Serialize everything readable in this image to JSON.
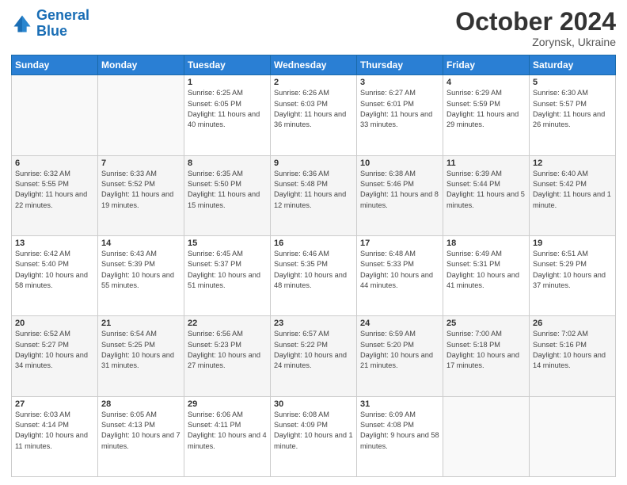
{
  "header": {
    "logo_line1": "General",
    "logo_line2": "Blue",
    "month_title": "October 2024",
    "location": "Zorynsk, Ukraine"
  },
  "weekdays": [
    "Sunday",
    "Monday",
    "Tuesday",
    "Wednesday",
    "Thursday",
    "Friday",
    "Saturday"
  ],
  "weeks": [
    [
      {
        "day": "",
        "sunrise": "",
        "sunset": "",
        "daylight": ""
      },
      {
        "day": "",
        "sunrise": "",
        "sunset": "",
        "daylight": ""
      },
      {
        "day": "1",
        "sunrise": "Sunrise: 6:25 AM",
        "sunset": "Sunset: 6:05 PM",
        "daylight": "Daylight: 11 hours and 40 minutes."
      },
      {
        "day": "2",
        "sunrise": "Sunrise: 6:26 AM",
        "sunset": "Sunset: 6:03 PM",
        "daylight": "Daylight: 11 hours and 36 minutes."
      },
      {
        "day": "3",
        "sunrise": "Sunrise: 6:27 AM",
        "sunset": "Sunset: 6:01 PM",
        "daylight": "Daylight: 11 hours and 33 minutes."
      },
      {
        "day": "4",
        "sunrise": "Sunrise: 6:29 AM",
        "sunset": "Sunset: 5:59 PM",
        "daylight": "Daylight: 11 hours and 29 minutes."
      },
      {
        "day": "5",
        "sunrise": "Sunrise: 6:30 AM",
        "sunset": "Sunset: 5:57 PM",
        "daylight": "Daylight: 11 hours and 26 minutes."
      }
    ],
    [
      {
        "day": "6",
        "sunrise": "Sunrise: 6:32 AM",
        "sunset": "Sunset: 5:55 PM",
        "daylight": "Daylight: 11 hours and 22 minutes."
      },
      {
        "day": "7",
        "sunrise": "Sunrise: 6:33 AM",
        "sunset": "Sunset: 5:52 PM",
        "daylight": "Daylight: 11 hours and 19 minutes."
      },
      {
        "day": "8",
        "sunrise": "Sunrise: 6:35 AM",
        "sunset": "Sunset: 5:50 PM",
        "daylight": "Daylight: 11 hours and 15 minutes."
      },
      {
        "day": "9",
        "sunrise": "Sunrise: 6:36 AM",
        "sunset": "Sunset: 5:48 PM",
        "daylight": "Daylight: 11 hours and 12 minutes."
      },
      {
        "day": "10",
        "sunrise": "Sunrise: 6:38 AM",
        "sunset": "Sunset: 5:46 PM",
        "daylight": "Daylight: 11 hours and 8 minutes."
      },
      {
        "day": "11",
        "sunrise": "Sunrise: 6:39 AM",
        "sunset": "Sunset: 5:44 PM",
        "daylight": "Daylight: 11 hours and 5 minutes."
      },
      {
        "day": "12",
        "sunrise": "Sunrise: 6:40 AM",
        "sunset": "Sunset: 5:42 PM",
        "daylight": "Daylight: 11 hours and 1 minute."
      }
    ],
    [
      {
        "day": "13",
        "sunrise": "Sunrise: 6:42 AM",
        "sunset": "Sunset: 5:40 PM",
        "daylight": "Daylight: 10 hours and 58 minutes."
      },
      {
        "day": "14",
        "sunrise": "Sunrise: 6:43 AM",
        "sunset": "Sunset: 5:39 PM",
        "daylight": "Daylight: 10 hours and 55 minutes."
      },
      {
        "day": "15",
        "sunrise": "Sunrise: 6:45 AM",
        "sunset": "Sunset: 5:37 PM",
        "daylight": "Daylight: 10 hours and 51 minutes."
      },
      {
        "day": "16",
        "sunrise": "Sunrise: 6:46 AM",
        "sunset": "Sunset: 5:35 PM",
        "daylight": "Daylight: 10 hours and 48 minutes."
      },
      {
        "day": "17",
        "sunrise": "Sunrise: 6:48 AM",
        "sunset": "Sunset: 5:33 PM",
        "daylight": "Daylight: 10 hours and 44 minutes."
      },
      {
        "day": "18",
        "sunrise": "Sunrise: 6:49 AM",
        "sunset": "Sunset: 5:31 PM",
        "daylight": "Daylight: 10 hours and 41 minutes."
      },
      {
        "day": "19",
        "sunrise": "Sunrise: 6:51 AM",
        "sunset": "Sunset: 5:29 PM",
        "daylight": "Daylight: 10 hours and 37 minutes."
      }
    ],
    [
      {
        "day": "20",
        "sunrise": "Sunrise: 6:52 AM",
        "sunset": "Sunset: 5:27 PM",
        "daylight": "Daylight: 10 hours and 34 minutes."
      },
      {
        "day": "21",
        "sunrise": "Sunrise: 6:54 AM",
        "sunset": "Sunset: 5:25 PM",
        "daylight": "Daylight: 10 hours and 31 minutes."
      },
      {
        "day": "22",
        "sunrise": "Sunrise: 6:56 AM",
        "sunset": "Sunset: 5:23 PM",
        "daylight": "Daylight: 10 hours and 27 minutes."
      },
      {
        "day": "23",
        "sunrise": "Sunrise: 6:57 AM",
        "sunset": "Sunset: 5:22 PM",
        "daylight": "Daylight: 10 hours and 24 minutes."
      },
      {
        "day": "24",
        "sunrise": "Sunrise: 6:59 AM",
        "sunset": "Sunset: 5:20 PM",
        "daylight": "Daylight: 10 hours and 21 minutes."
      },
      {
        "day": "25",
        "sunrise": "Sunrise: 7:00 AM",
        "sunset": "Sunset: 5:18 PM",
        "daylight": "Daylight: 10 hours and 17 minutes."
      },
      {
        "day": "26",
        "sunrise": "Sunrise: 7:02 AM",
        "sunset": "Sunset: 5:16 PM",
        "daylight": "Daylight: 10 hours and 14 minutes."
      }
    ],
    [
      {
        "day": "27",
        "sunrise": "Sunrise: 6:03 AM",
        "sunset": "Sunset: 4:14 PM",
        "daylight": "Daylight: 10 hours and 11 minutes."
      },
      {
        "day": "28",
        "sunrise": "Sunrise: 6:05 AM",
        "sunset": "Sunset: 4:13 PM",
        "daylight": "Daylight: 10 hours and 7 minutes."
      },
      {
        "day": "29",
        "sunrise": "Sunrise: 6:06 AM",
        "sunset": "Sunset: 4:11 PM",
        "daylight": "Daylight: 10 hours and 4 minutes."
      },
      {
        "day": "30",
        "sunrise": "Sunrise: 6:08 AM",
        "sunset": "Sunset: 4:09 PM",
        "daylight": "Daylight: 10 hours and 1 minute."
      },
      {
        "day": "31",
        "sunrise": "Sunrise: 6:09 AM",
        "sunset": "Sunset: 4:08 PM",
        "daylight": "Daylight: 9 hours and 58 minutes."
      },
      {
        "day": "",
        "sunrise": "",
        "sunset": "",
        "daylight": ""
      },
      {
        "day": "",
        "sunrise": "",
        "sunset": "",
        "daylight": ""
      }
    ]
  ]
}
